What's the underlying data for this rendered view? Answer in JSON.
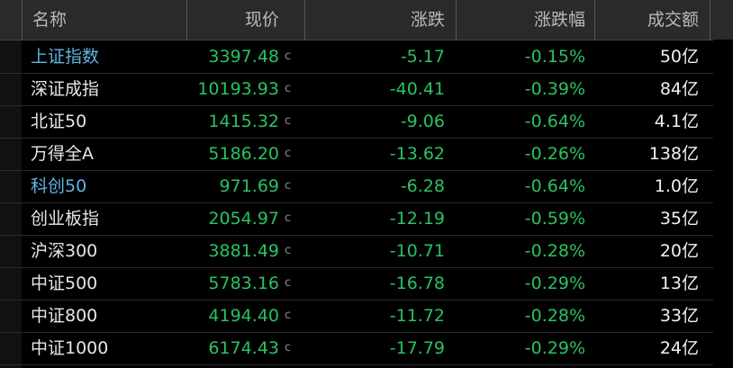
{
  "header": {
    "name": "名称",
    "price": "现价",
    "change": "涨跌",
    "change_pct": "涨跌幅",
    "volume": "成交额"
  },
  "rows": [
    {
      "name": "上证指数",
      "name_is_link": true,
      "price": "3397.48",
      "flag": "c",
      "change": "-5.17",
      "pct": "-0.15%",
      "amount": "50亿"
    },
    {
      "name": "深证成指",
      "name_is_link": false,
      "price": "10193.93",
      "flag": "c",
      "change": "-40.41",
      "pct": "-0.39%",
      "amount": "84亿"
    },
    {
      "name": "北证50",
      "name_is_link": false,
      "price": "1415.32",
      "flag": "c",
      "change": "-9.06",
      "pct": "-0.64%",
      "amount": "4.1亿"
    },
    {
      "name": "万得全A",
      "name_is_link": false,
      "price": "5186.20",
      "flag": "c",
      "change": "-13.62",
      "pct": "-0.26%",
      "amount": "138亿"
    },
    {
      "name": "科创50",
      "name_is_link": true,
      "price": "971.69",
      "flag": "c",
      "change": "-6.28",
      "pct": "-0.64%",
      "amount": "1.0亿"
    },
    {
      "name": "创业板指",
      "name_is_link": false,
      "price": "2054.97",
      "flag": "c",
      "change": "-12.19",
      "pct": "-0.59%",
      "amount": "35亿"
    },
    {
      "name": "沪深300",
      "name_is_link": false,
      "price": "3881.49",
      "flag": "c",
      "change": "-10.71",
      "pct": "-0.28%",
      "amount": "20亿"
    },
    {
      "name": "中证500",
      "name_is_link": false,
      "price": "5783.16",
      "flag": "c",
      "change": "-16.78",
      "pct": "-0.29%",
      "amount": "13亿"
    },
    {
      "name": "中证800",
      "name_is_link": false,
      "price": "4194.40",
      "flag": "c",
      "change": "-11.72",
      "pct": "-0.28%",
      "amount": "33亿"
    },
    {
      "name": "中证1000",
      "name_is_link": false,
      "price": "6174.43",
      "flag": "c",
      "change": "-17.79",
      "pct": "-0.29%",
      "amount": "24亿"
    }
  ],
  "colors": {
    "background": "#000000",
    "header_bg": "#2a2a2a",
    "down": "#29c262",
    "link": "#5fb4e0",
    "text": "#e6e6e6"
  }
}
